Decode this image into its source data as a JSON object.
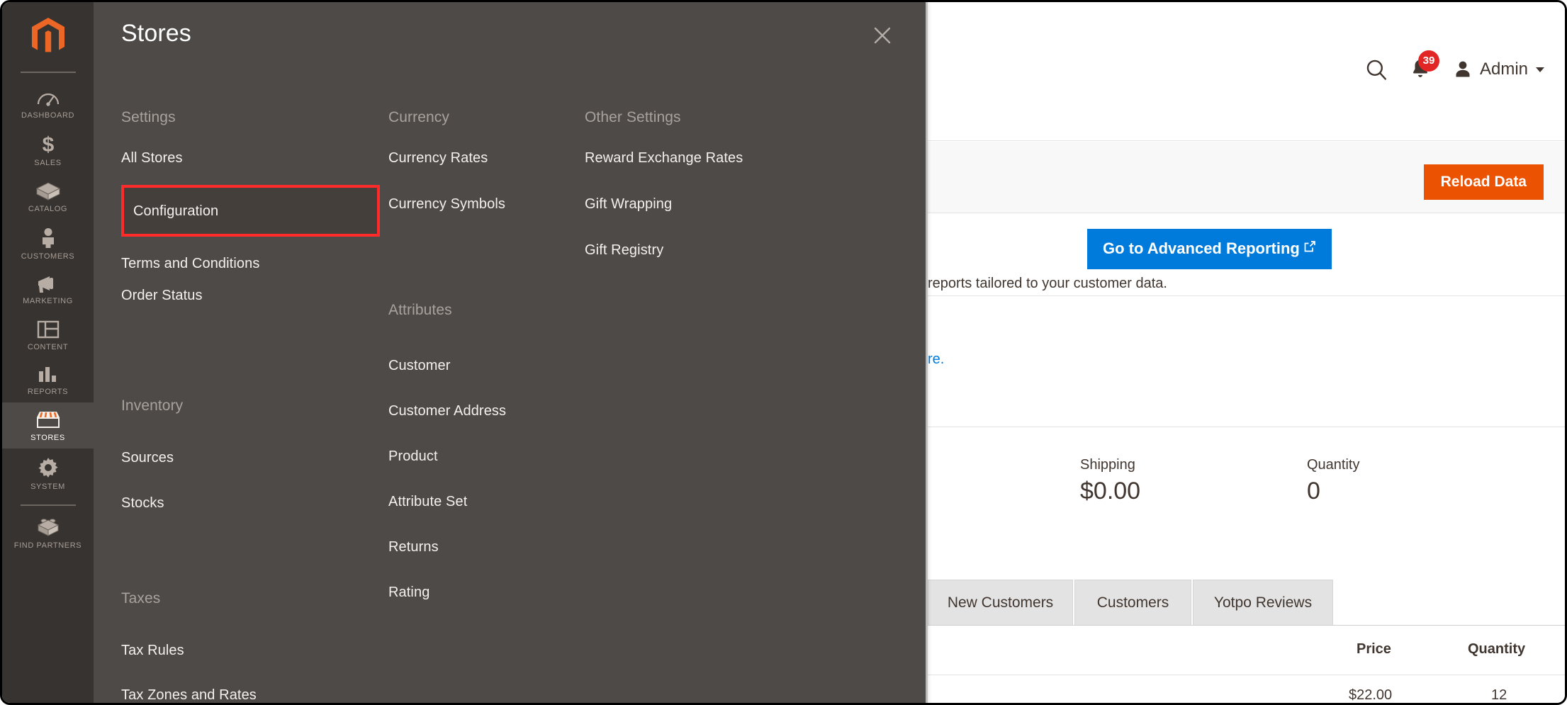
{
  "sidebar": {
    "logo": "magento-logo",
    "items": [
      {
        "label": "DASHBOARD",
        "icon": "dashboard-gauge-icon",
        "active": false
      },
      {
        "label": "SALES",
        "icon": "dollar-sign-icon",
        "active": false
      },
      {
        "label": "CATALOG",
        "icon": "box-icon",
        "active": false
      },
      {
        "label": "CUSTOMERS",
        "icon": "person-icon",
        "active": false
      },
      {
        "label": "MARKETING",
        "icon": "megaphone-icon",
        "active": false
      },
      {
        "label": "CONTENT",
        "icon": "layout-icon",
        "active": false
      },
      {
        "label": "REPORTS",
        "icon": "bar-chart-icon",
        "active": false
      },
      {
        "label": "STORES",
        "icon": "storefront-icon",
        "active": true
      },
      {
        "label": "SYSTEM",
        "icon": "gear-icon",
        "active": false
      },
      {
        "label": "FIND PARTNERS",
        "icon": "lego-block-icon",
        "active": false
      }
    ]
  },
  "menu_panel": {
    "title": "Stores",
    "close_label": "close-icon",
    "columns": [
      {
        "id": "col-settings",
        "groups": [
          {
            "title": "Settings",
            "items": [
              {
                "label": "All Stores",
                "highlighted": false
              },
              {
                "label": "Configuration",
                "highlighted": true
              },
              {
                "label": "Terms and Conditions",
                "highlighted": false
              },
              {
                "label": "Order Status",
                "highlighted": false
              }
            ]
          },
          {
            "title": "Inventory",
            "items": [
              {
                "label": "Sources",
                "highlighted": false
              },
              {
                "label": "Stocks",
                "highlighted": false
              }
            ]
          },
          {
            "title": "Taxes",
            "items": [
              {
                "label": "Tax Rules",
                "highlighted": false
              },
              {
                "label": "Tax Zones and Rates",
                "highlighted": false
              }
            ]
          }
        ]
      },
      {
        "id": "col-currency",
        "groups": [
          {
            "title": "Currency",
            "items": [
              {
                "label": "Currency Rates",
                "highlighted": false
              },
              {
                "label": "Currency Symbols",
                "highlighted": false
              }
            ]
          },
          {
            "title": "Attributes",
            "items": [
              {
                "label": "Customer",
                "highlighted": false
              },
              {
                "label": "Customer Address",
                "highlighted": false
              },
              {
                "label": "Product",
                "highlighted": false
              },
              {
                "label": "Attribute Set",
                "highlighted": false
              },
              {
                "label": "Returns",
                "highlighted": false
              },
              {
                "label": "Rating",
                "highlighted": false
              }
            ]
          }
        ]
      },
      {
        "id": "col-other",
        "groups": [
          {
            "title": "Other Settings",
            "items": [
              {
                "label": "Reward Exchange Rates",
                "highlighted": false
              },
              {
                "label": "Gift Wrapping",
                "highlighted": false
              },
              {
                "label": "Gift Registry",
                "highlighted": false
              }
            ]
          }
        ]
      }
    ],
    "highlight_color": "#ff2a2a"
  },
  "header": {
    "search_icon": "search-icon",
    "notifications_icon": "bell-icon",
    "notifications_count": "39",
    "user_icon": "user-avatar-icon",
    "user_name": "Admin",
    "caret": "chevron-down-icon"
  },
  "page_actions": {
    "reload_label": "Reload Data"
  },
  "advanced_reporting": {
    "description_fragment": "reports tailored to your customer data.",
    "button_label": "Go to Advanced Reporting",
    "external_icon": "external-link-icon"
  },
  "chart_section": {
    "link_fragment": "re."
  },
  "stats": [
    {
      "label": "Shipping",
      "value": "$0.00"
    },
    {
      "label": "Quantity",
      "value": "0"
    }
  ],
  "tabs": [
    {
      "label": "New Customers",
      "selected": false
    },
    {
      "label": "Customers",
      "selected": false
    },
    {
      "label": "Yotpo Reviews",
      "selected": false
    }
  ],
  "grid": {
    "columns": [
      "Price",
      "Quantity"
    ],
    "rows": [
      {
        "price": "$22.00",
        "quantity": "12"
      }
    ]
  },
  "colors": {
    "sidebar_bg": "#373330",
    "panel_bg": "#4e4a47",
    "accent_orange": "#eb5202",
    "accent_blue": "#007bdb",
    "badge_red": "#e22626",
    "highlight_red": "#ff2a2a"
  }
}
